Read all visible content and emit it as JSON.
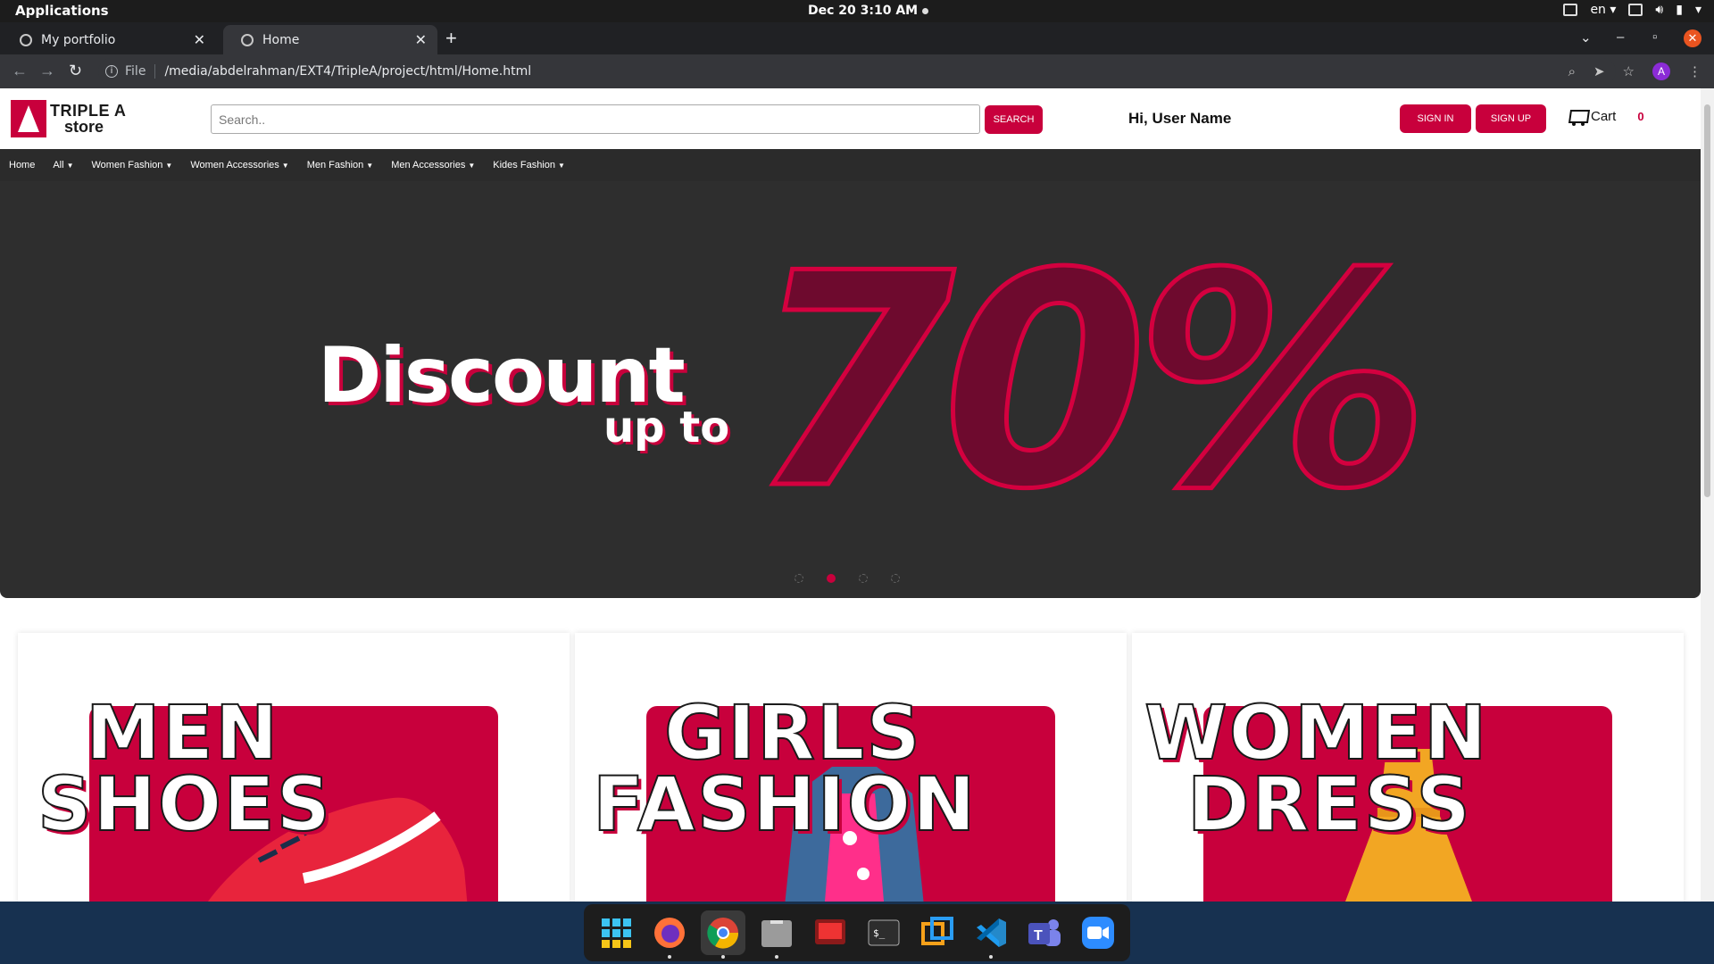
{
  "system": {
    "activities": "Applications",
    "clock": "Dec 20  3:10 AM",
    "lang": "en"
  },
  "browser": {
    "tabs": [
      {
        "title": "My portfolio"
      },
      {
        "title": "Home"
      }
    ],
    "url_scheme": "File",
    "url": "/media/abdelrahman/EXT4/TripleA/project/html/Home.html",
    "profile_initial": "A"
  },
  "site": {
    "logo_line1": "TRIPLE A",
    "logo_line2": "store",
    "search_placeholder": "Search..",
    "search_button": "SEARCH",
    "greeting": "Hi, User Name",
    "signin": "SIGN IN",
    "signup": "SIGN UP",
    "cart_label": "Cart",
    "cart_count": "0",
    "menu": [
      {
        "label": "Home"
      },
      {
        "label": "All"
      },
      {
        "label": "Women Fashion"
      },
      {
        "label": "Women Accessories"
      },
      {
        "label": "Men Fashion"
      },
      {
        "label": "Men Accessories"
      },
      {
        "label": "Kides Fashion"
      }
    ],
    "banner": {
      "headline": "Discount",
      "subline": "up to",
      "percent": "70%",
      "active_slide": 2,
      "slides": 4
    },
    "cards": [
      {
        "line1": "MEN",
        "line2": "SHOES"
      },
      {
        "line1": "GIRLS",
        "line2": "FASHION"
      },
      {
        "line1": "WOMEN",
        "line2": "DRESS"
      }
    ],
    "accent": "#c8003c"
  },
  "dock": {
    "apps": [
      "apps-grid-icon",
      "firefox-icon",
      "chrome-icon",
      "files-icon",
      "screen-recorder-icon",
      "terminal-icon",
      "remote-desktop-icon",
      "vscode-icon",
      "teams-icon",
      "zoom-icon"
    ]
  }
}
